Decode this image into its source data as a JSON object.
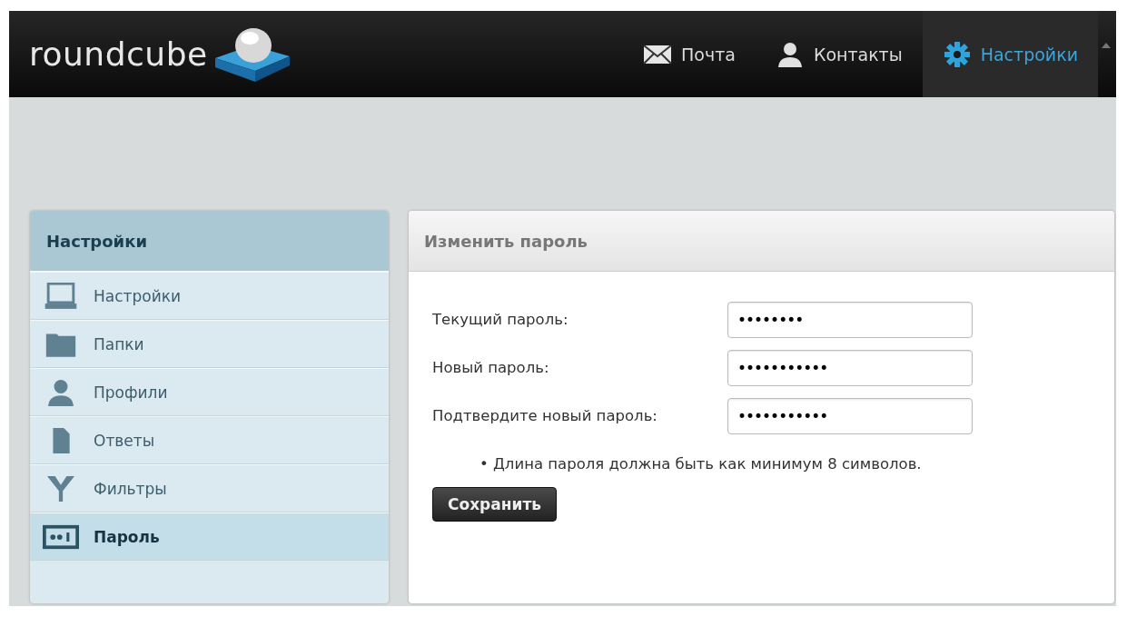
{
  "header": {
    "logo": "roundcube",
    "nav": [
      {
        "label": "Почта",
        "selected": false
      },
      {
        "label": "Контакты",
        "selected": false
      },
      {
        "label": "Настройки",
        "selected": true
      }
    ]
  },
  "sidebar": {
    "title": "Настройки",
    "items": [
      {
        "label": "Настройки",
        "selected": false
      },
      {
        "label": "Папки",
        "selected": false
      },
      {
        "label": "Профили",
        "selected": false
      },
      {
        "label": "Ответы",
        "selected": false
      },
      {
        "label": "Фильтры",
        "selected": false
      },
      {
        "label": "Пароль",
        "selected": true
      }
    ]
  },
  "panel": {
    "title": "Изменить пароль",
    "fields": [
      {
        "label": "Текущий пароль:",
        "value": "••••••••"
      },
      {
        "label": "Новый пароль:",
        "value": "•••••••••••"
      },
      {
        "label": "Подтвердите новый пароль:",
        "value": "•••••••••••"
      }
    ],
    "hint": "• Длина пароля должна быть как минимум 8 символов.",
    "button": "Сохранить"
  }
}
